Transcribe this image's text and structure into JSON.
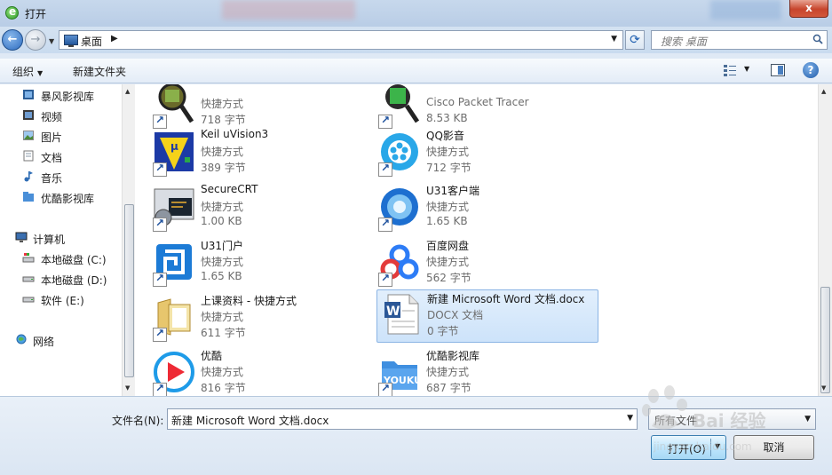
{
  "window": {
    "title": "打开",
    "close_label": "x"
  },
  "nav": {
    "breadcrumb": "桌面",
    "search_placeholder": "搜索 桌面"
  },
  "toolbar": {
    "organize_label": "组织",
    "new_folder_label": "新建文件夹"
  },
  "sidebar": {
    "items": [
      {
        "label": "暴风影视库",
        "icon": "film-library-icon"
      },
      {
        "label": "视频",
        "icon": "video-library-icon"
      },
      {
        "label": "图片",
        "icon": "pictures-library-icon"
      },
      {
        "label": "文档",
        "icon": "documents-library-icon"
      },
      {
        "label": "音乐",
        "icon": "music-library-icon"
      },
      {
        "label": "优酷影视库",
        "icon": "youku-library-icon"
      },
      {
        "label": "计算机",
        "icon": "computer-icon"
      },
      {
        "label": "本地磁盘 (C:)",
        "icon": "system-drive-icon"
      },
      {
        "label": "本地磁盘 (D:)",
        "icon": "drive-icon"
      },
      {
        "label": "软件 (E:)",
        "icon": "drive-icon"
      },
      {
        "label": "网络",
        "icon": "network-icon"
      }
    ]
  },
  "files": [
    {
      "name": "",
      "type": "快捷方式",
      "size": "718 字节",
      "icon": "magnifier-app-icon",
      "shortcut": true
    },
    {
      "name": "Keil uVision3",
      "type": "快捷方式",
      "size": "389 字节",
      "icon": "keil-icon",
      "shortcut": true
    },
    {
      "name": "SecureCRT",
      "type": "快捷方式",
      "size": "1.00 KB",
      "icon": "securecrt-icon",
      "shortcut": true
    },
    {
      "name": "U31门户",
      "type": "快捷方式",
      "size": "1.65 KB",
      "icon": "u31-portal-icon",
      "shortcut": true
    },
    {
      "name": "上课资料 - 快捷方式",
      "type": "快捷方式",
      "size": "611 字节",
      "icon": "folder-icon",
      "shortcut": true
    },
    {
      "name": "优酷",
      "type": "快捷方式",
      "size": "816 字节",
      "icon": "youku-icon",
      "shortcut": true
    },
    {
      "name": "",
      "type": "Cisco Packet Tracer",
      "size": "8.53 KB",
      "icon": "packet-tracer-icon",
      "shortcut": true
    },
    {
      "name": "QQ影音",
      "type": "快捷方式",
      "size": "712 字节",
      "icon": "qq-player-icon",
      "shortcut": true
    },
    {
      "name": "U31客户端",
      "type": "快捷方式",
      "size": "1.65 KB",
      "icon": "u31-client-icon",
      "shortcut": true
    },
    {
      "name": "百度网盘",
      "type": "快捷方式",
      "size": "562 字节",
      "icon": "baidu-netdisk-icon",
      "shortcut": true
    },
    {
      "name": "新建 Microsoft Word 文档.docx",
      "type": "DOCX 文档",
      "size": "0 字节",
      "icon": "word-document-icon",
      "shortcut": false,
      "selected": true
    },
    {
      "name": "优酷影视库",
      "type": "快捷方式",
      "size": "687 字节",
      "icon": "youku-library-icon",
      "shortcut": true
    }
  ],
  "bottom": {
    "filename_label": "文件名(N):",
    "filename_value": "新建 Microsoft Word 文档.docx",
    "filetype_value": "所有文件",
    "open_label": "打开(O)",
    "cancel_label": "取消"
  },
  "watermark": {
    "text": "Bai 经验",
    "url": "jingyan.baidu.com"
  },
  "colors": {
    "selection": "#cde3fa",
    "window_frame": "#c7d8ec"
  }
}
